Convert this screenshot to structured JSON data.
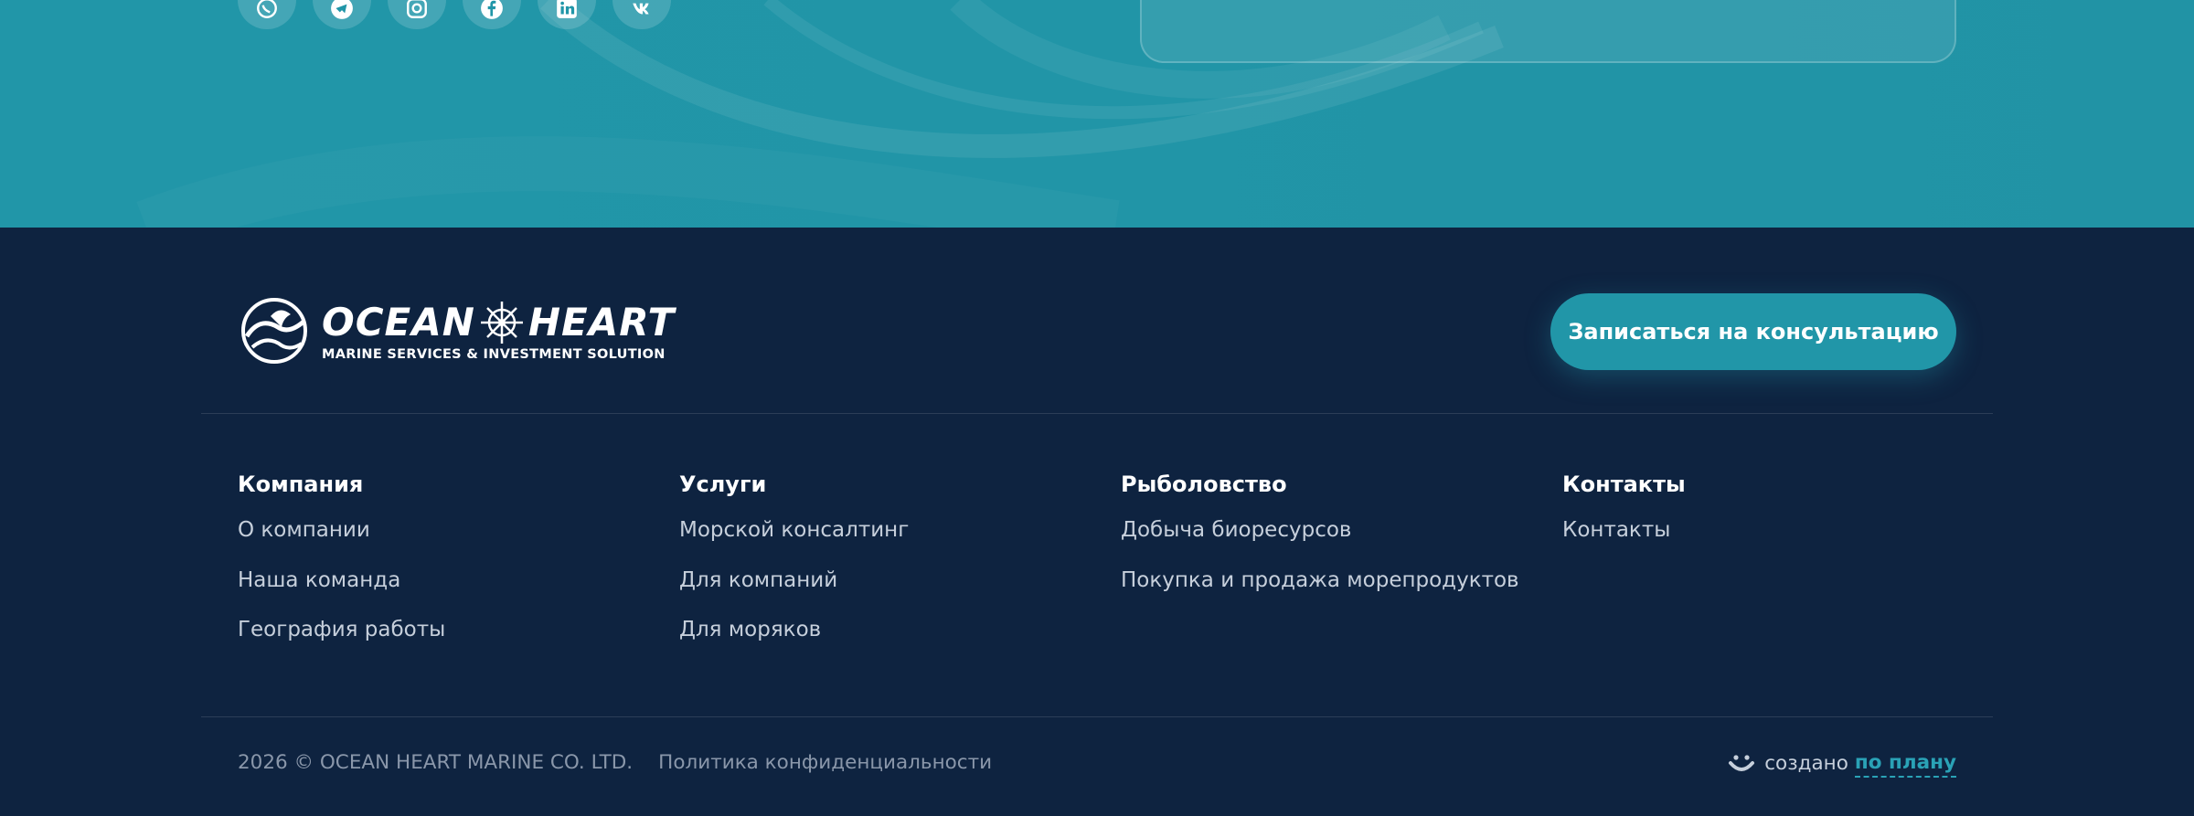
{
  "colors": {
    "top_band": "#2196a8",
    "footer_bg": "#0e2340",
    "accent": "#2196a8",
    "link_text": "#c6cfdb",
    "muted_text": "#8a97aa",
    "made_link": "#2aa2b6"
  },
  "social": [
    {
      "name": "whatsapp-icon"
    },
    {
      "name": "telegram-icon"
    },
    {
      "name": "instagram-icon"
    },
    {
      "name": "facebook-icon"
    },
    {
      "name": "linkedin-icon"
    },
    {
      "name": "vk-icon"
    }
  ],
  "logo": {
    "name_left": "OCEAN",
    "name_right": "HEART",
    "tagline": "MARINE SERVICES & INVESTMENT SOLUTION"
  },
  "cta": {
    "label": "Записаться на консультацию"
  },
  "columns": [
    {
      "title": "Компания",
      "links": [
        "О компании",
        "Наша команда",
        "География работы"
      ]
    },
    {
      "title": "Услуги",
      "links": [
        "Морской консалтинг",
        "Для компаний",
        "Для моряков"
      ]
    },
    {
      "title": "Рыболовство",
      "links": [
        "Добыча биоресурсов",
        "Покупка и продажа морепродуктов"
      ]
    },
    {
      "title": "Контакты",
      "links": [
        "Контакты"
      ]
    }
  ],
  "bottom": {
    "copyright": "2026 © OCEAN HEART MARINE CO. LTD.",
    "privacy": "Политика конфиденциальности",
    "made_text": "создано",
    "made_link": "по плану"
  }
}
